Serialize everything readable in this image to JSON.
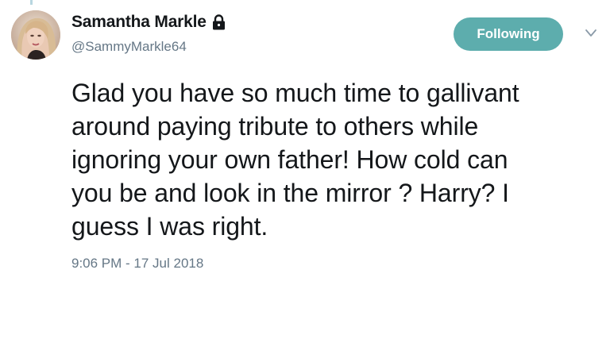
{
  "user": {
    "display_name": "Samantha Markle",
    "handle": "@SammyMarkle64",
    "protected_icon": "lock-icon",
    "avatar_icon": "avatar"
  },
  "actions": {
    "follow_label": "Following",
    "follow_color": "#5dadad",
    "menu_icon": "chevron-down-icon"
  },
  "tweet": {
    "lines": [
      "Glad you have so much time to gallivant",
      "around paying tribute to others while",
      "ignoring your own father! How cold can",
      "you be and look in the mirror ? Harry?  I",
      "guess I was right."
    ],
    "timestamp": "9:06 PM - 17 Jul 2018"
  },
  "colors": {
    "text_primary": "#14171a",
    "text_secondary": "#657786",
    "background": "#ffffff"
  }
}
